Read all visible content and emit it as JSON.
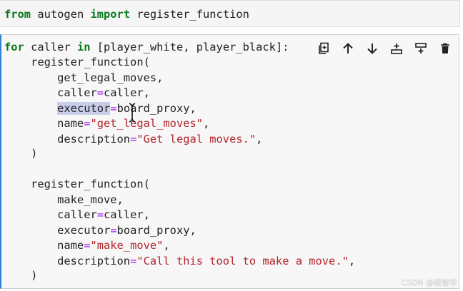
{
  "cell1": {
    "kw_from": "from",
    "module": " autogen ",
    "kw_import": "import",
    "name": " register_function"
  },
  "code": {
    "l1_for": "for",
    "l1_mid": " caller ",
    "l1_in": "in",
    "l1_rest": " [player_white, player_black]:",
    "b1_open": "    register_function(",
    "b1_arg1": "        get_legal_moves,",
    "b1_caller_key": "        caller",
    "b1_caller_eq": "=",
    "b1_caller_val": "caller,",
    "b1_exec_indent": "        ",
    "b1_exec_key": "executor",
    "b1_exec_eq": "=",
    "b1_exec_val": "board_proxy,",
    "b1_name_key": "        name",
    "b1_name_eq": "=",
    "b1_name_val": "\"get_legal_moves\"",
    "b1_name_comma": ",",
    "b1_desc_key": "        description",
    "b1_desc_eq": "=",
    "b1_desc_val": "\"Get legal moves.\"",
    "b1_desc_comma": ",",
    "b1_close": "    )",
    "b2_open": "    register_function(",
    "b2_arg1": "        make_move,",
    "b2_caller_key": "        caller",
    "b2_caller_eq": "=",
    "b2_caller_val": "caller,",
    "b2_exec_key": "        executor",
    "b2_exec_eq": "=",
    "b2_exec_val": "board_proxy,",
    "b2_name_key": "        name",
    "b2_name_eq": "=",
    "b2_name_val": "\"make_move\"",
    "b2_name_comma": ",",
    "b2_desc_key": "        description",
    "b2_desc_eq": "=",
    "b2_desc_val": "\"Call this tool to make a move.\"",
    "b2_desc_comma": ",",
    "b2_close": "    )"
  },
  "toolbar": {
    "icons": [
      "duplicate-icon",
      "arrow-up-icon",
      "arrow-down-icon",
      "insert-above-icon",
      "insert-below-icon",
      "trash-icon"
    ]
  },
  "watermark": "CSDN @段智华",
  "colors": {
    "keyword": "#0b7a1f",
    "operator": "#a020f0",
    "string": "#b2232a",
    "active_cell_border": "#2f7fd6"
  }
}
